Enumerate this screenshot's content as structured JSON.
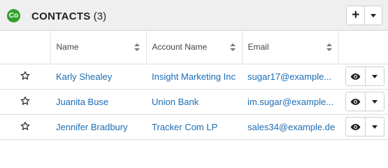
{
  "header": {
    "module_badge": "Co",
    "title": "CONTACTS",
    "count": "(3)",
    "icons": {
      "add": "plus-icon",
      "menu": "caret-down-icon"
    },
    "badge_color": "#33a02c"
  },
  "table": {
    "columns": [
      "Name",
      "Account Name",
      "Email"
    ],
    "rows": [
      {
        "name": "Karly Shealey",
        "account": "Insight Marketing Inc",
        "email": "sugar17@example..."
      },
      {
        "name": "Juanita Buse",
        "account": "Union Bank",
        "email": "im.sugar@example..."
      },
      {
        "name": "Jennifer Bradbury",
        "account": "Tracker Com LP",
        "email": "sales34@example.de"
      }
    ],
    "row_icons": {
      "favorite": "star-outline-icon",
      "preview": "eye-icon",
      "menu": "caret-down-icon"
    },
    "link_color": "#1b6db5"
  }
}
